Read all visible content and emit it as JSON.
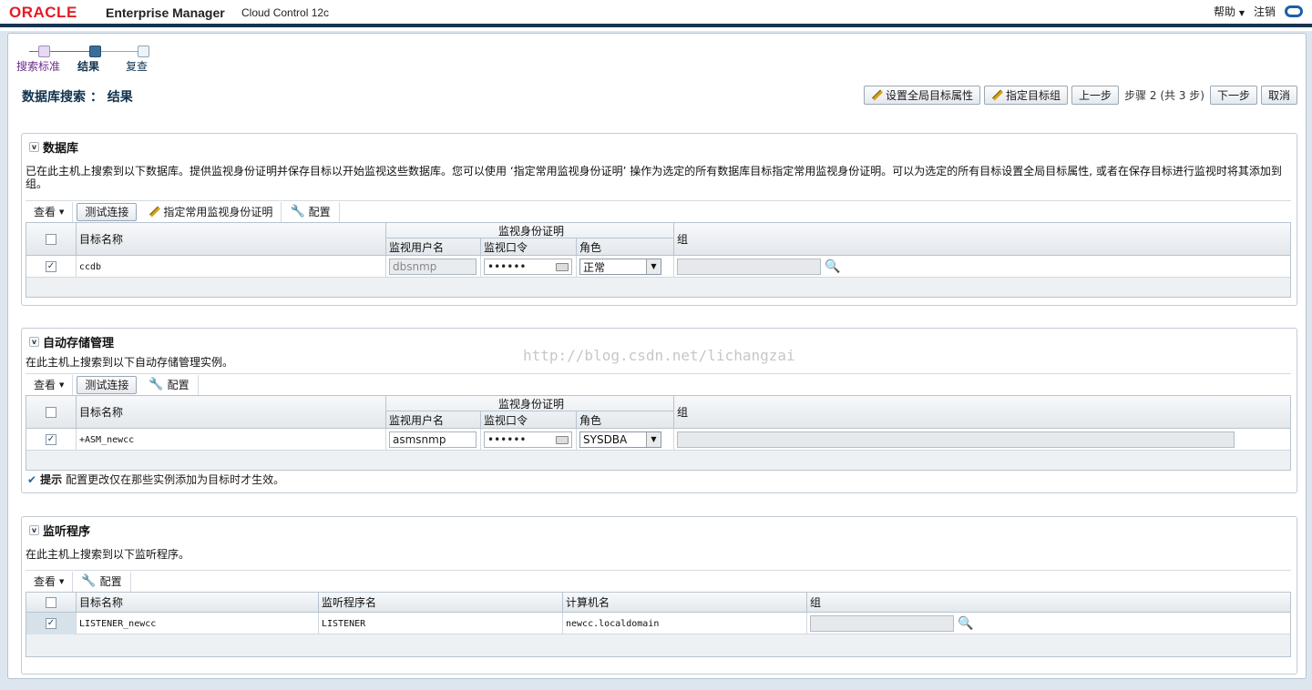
{
  "header": {
    "logo": "ORACLE",
    "product": "Enterprise Manager",
    "edition": "Cloud Control 12c",
    "help": "帮助",
    "logout": "注销"
  },
  "train": {
    "steps": [
      {
        "label": "搜索标准",
        "state": "visited"
      },
      {
        "label": "结果",
        "state": "current"
      },
      {
        "label": "复查",
        "state": "unvisited"
      }
    ]
  },
  "page": {
    "title": "数据库搜索 ： 结果",
    "buttons": {
      "set_global": "设置全局目标属性",
      "assign_group": "指定目标组",
      "back": "上一步",
      "step_text": "步骤 2 (共 3 步)",
      "next": "下一步",
      "cancel": "取消"
    }
  },
  "db_section": {
    "title": "数据库",
    "description": "已在此主机上搜索到以下数据库。提供监视身份证明并保存目标以开始监视这些数据库。您可以使用 ‘指定常用监视身份证明’ 操作为选定的所有数据库目标指定常用监视身份证明。可以为选定的所有目标设置全局目标属性, 或者在保存目标进行监视时将其添加到组。",
    "toolbar": {
      "view": "查看",
      "test": "测试连接",
      "assign_cred": "指定常用监视身份证明",
      "config": "配置"
    },
    "columns": {
      "target": "目标名称",
      "cred_group": "监视身份证明",
      "user": "监视用户名",
      "password": "监视口令",
      "role": "角色",
      "group": "组"
    },
    "rows": [
      {
        "checked": "✓",
        "target": "ccdb",
        "user": "dbsnmp",
        "password": "••••••",
        "role": "正常",
        "group": ""
      }
    ]
  },
  "asm_section": {
    "title": "自动存储管理",
    "description": "在此主机上搜索到以下自动存储管理实例。",
    "toolbar": {
      "view": "查看",
      "test": "测试连接",
      "config": "配置"
    },
    "columns": {
      "target": "目标名称",
      "cred_group": "监视身份证明",
      "user": "监视用户名",
      "password": "监视口令",
      "role": "角色",
      "group": "组"
    },
    "rows": [
      {
        "checked": "✓",
        "target": "+ASM_newcc",
        "user": "asmsnmp",
        "password": "••••••",
        "role": "SYSDBA",
        "group": ""
      }
    ],
    "tip_label": "提示",
    "tip_text": "配置更改仅在那些实例添加为目标时才生效。"
  },
  "listener_section": {
    "title": "监听程序",
    "description": "在此主机上搜索到以下监听程序。",
    "toolbar": {
      "view": "查看",
      "config": "配置"
    },
    "columns": {
      "target": "目标名称",
      "listener": "监听程序名",
      "host": "计算机名",
      "group": "组"
    },
    "rows": [
      {
        "checked": "✓",
        "target": "LISTENER_newcc",
        "listener": "LISTENER",
        "host": "newcc.localdomain",
        "group": ""
      }
    ]
  },
  "watermark": "http://blog.csdn.net/lichangzai"
}
